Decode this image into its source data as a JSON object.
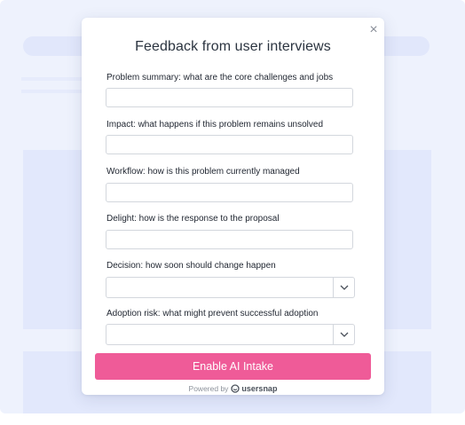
{
  "modal": {
    "title": "Feedback from user interviews",
    "close_symbol": "×"
  },
  "fields": [
    {
      "label": "Problem summary: what are the core challenges and jobs",
      "type": "text",
      "value": "",
      "placeholder": ""
    },
    {
      "label": "Impact: what happens if this problem remains unsolved",
      "type": "text",
      "value": "",
      "placeholder": ""
    },
    {
      "label": "Workflow: how is this problem currently managed",
      "type": "text",
      "value": "",
      "placeholder": ""
    },
    {
      "label": "Delight: how is the response to the proposal",
      "type": "text",
      "value": "",
      "placeholder": ""
    },
    {
      "label": "Decision: how soon should change happen",
      "type": "select",
      "value": ""
    },
    {
      "label": "Adoption risk: what might prevent successful adoption",
      "type": "select",
      "value": ""
    }
  ],
  "cta": {
    "label": "Enable AI Intake",
    "color": "#ef5b98"
  },
  "footer": {
    "powered_by": "Powered by",
    "brand": "usersnap",
    "brand_icon": "usersnap-logo-icon"
  },
  "icons": {
    "close": "close-icon",
    "dropdown": "chevron-down-icon"
  }
}
